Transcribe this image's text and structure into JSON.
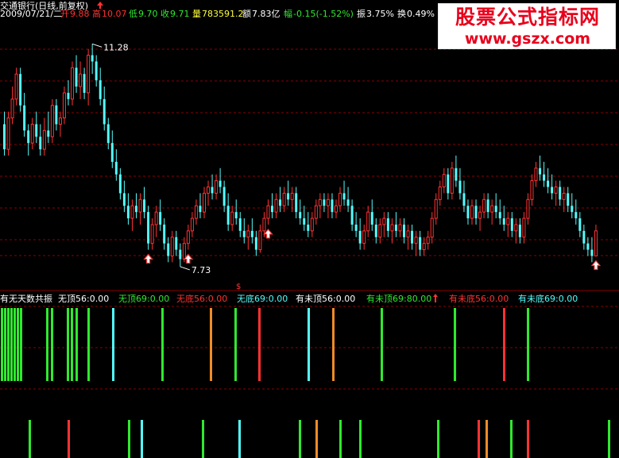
{
  "header": {
    "title": "交通银行(日线,前复权)",
    "date": "2009/07/21/二",
    "open_label": "开",
    "open": "9.88",
    "high_label": "高",
    "high": "10.07",
    "low_label": "低",
    "low": "9.70",
    "close_label": "收",
    "close": "9.71",
    "volume_label": "量",
    "volume": "783591.2",
    "amount_label": "额",
    "amount": "7.83亿",
    "change_label": "幅",
    "change": "-0.15(-1.52%)",
    "amplitude_label": "振",
    "amplitude": "3.75%",
    "turnover_label": "换",
    "turnover": "0.49%"
  },
  "colors": {
    "up": "#ff3232",
    "down": "#54fcfc",
    "background": "#000000",
    "grid": "#8b0000",
    "green": "#2fe92f",
    "orange": "#f08c28",
    "white": "#ffffff",
    "yellow": "#ffff3c"
  },
  "logo": {
    "title": "股票公式指标网",
    "url": "www.gszx.com"
  },
  "indicator": {
    "name": "有无天数共振",
    "entries": [
      {
        "label": "无顶56:",
        "value": "0.00",
        "color": "#ffffff"
      },
      {
        "label": "无顶69:",
        "value": "0.00",
        "color": "#2fe92f"
      },
      {
        "label": "无底56:",
        "value": "0.00",
        "color": "#ff3232"
      },
      {
        "label": "无底69:",
        "value": "0.00",
        "color": "#54fcfc"
      },
      {
        "label": "有未顶56:",
        "value": "0.00",
        "color": "#ffffff"
      },
      {
        "label": "有未顶69:",
        "value": "80.00",
        "color": "#2fe92f"
      },
      {
        "label": "有未底56:",
        "value": "0.00",
        "color": "#ff3232"
      },
      {
        "label": "有未底69:",
        "value": "0.00",
        "color": "#54fcfc"
      }
    ]
  },
  "chart_data": {
    "type": "candlestick",
    "ylim": [
      7.4,
      11.6
    ],
    "grid": true,
    "annotations": [
      {
        "text": "11.28",
        "index": 22,
        "price": 11.28,
        "kind": "high"
      },
      {
        "text": "7.73",
        "index": 44,
        "price": 7.73,
        "kind": "low"
      }
    ],
    "buy_arrows": [
      36,
      46,
      66,
      148
    ],
    "candles": [
      [
        10.0,
        10.2,
        9.5,
        9.6
      ],
      [
        9.6,
        10.2,
        9.5,
        10.1
      ],
      [
        10.1,
        10.6,
        10.0,
        10.4
      ],
      [
        10.4,
        10.9,
        10.3,
        10.8
      ],
      [
        10.8,
        10.9,
        10.2,
        10.3
      ],
      [
        10.3,
        10.5,
        9.8,
        9.9
      ],
      [
        9.9,
        10.0,
        9.5,
        9.7
      ],
      [
        9.7,
        10.1,
        9.6,
        10.0
      ],
      [
        10.0,
        10.2,
        9.7,
        9.8
      ],
      [
        9.8,
        10.0,
        9.5,
        9.6
      ],
      [
        9.6,
        10.1,
        9.5,
        9.9
      ],
      [
        9.9,
        10.2,
        9.7,
        9.8
      ],
      [
        9.8,
        10.4,
        9.7,
        10.3
      ],
      [
        10.3,
        10.4,
        9.9,
        10.0
      ],
      [
        10.0,
        10.2,
        9.8,
        10.1
      ],
      [
        10.1,
        10.6,
        10.0,
        10.5
      ],
      [
        10.5,
        10.7,
        10.3,
        10.4
      ],
      [
        10.4,
        11.0,
        10.3,
        10.9
      ],
      [
        10.9,
        11.1,
        10.5,
        10.6
      ],
      [
        10.6,
        11.0,
        10.4,
        10.8
      ],
      [
        10.8,
        10.9,
        10.4,
        10.5
      ],
      [
        10.5,
        11.2,
        10.3,
        11.1
      ],
      [
        11.1,
        11.28,
        10.8,
        11.0
      ],
      [
        11.0,
        11.1,
        10.6,
        10.7
      ],
      [
        10.7,
        10.9,
        10.3,
        10.4
      ],
      [
        10.4,
        10.6,
        9.9,
        10.0
      ],
      [
        10.0,
        10.1,
        9.6,
        9.7
      ],
      [
        9.7,
        9.9,
        9.3,
        9.4
      ],
      [
        9.4,
        9.6,
        9.1,
        9.2
      ],
      [
        9.2,
        9.3,
        8.8,
        8.9
      ],
      [
        8.9,
        9.1,
        8.6,
        8.7
      ],
      [
        8.7,
        8.9,
        8.4,
        8.5
      ],
      [
        8.5,
        8.8,
        8.3,
        8.7
      ],
      [
        8.7,
        8.9,
        8.5,
        8.6
      ],
      [
        8.6,
        8.9,
        8.4,
        8.8
      ],
      [
        8.8,
        9.0,
        8.5,
        8.6
      ],
      [
        8.6,
        8.7,
        8.0,
        8.1
      ],
      [
        8.1,
        8.5,
        8.0,
        8.4
      ],
      [
        8.4,
        8.7,
        8.2,
        8.6
      ],
      [
        8.6,
        8.8,
        8.3,
        8.4
      ],
      [
        8.4,
        8.5,
        8.0,
        8.1
      ],
      [
        8.1,
        8.2,
        7.8,
        7.9
      ],
      [
        7.9,
        8.3,
        7.8,
        8.2
      ],
      [
        8.2,
        8.3,
        7.9,
        8.0
      ],
      [
        8.0,
        8.1,
        7.73,
        7.85
      ],
      [
        7.85,
        8.2,
        7.8,
        8.1
      ],
      [
        8.1,
        8.4,
        8.0,
        8.3
      ],
      [
        8.3,
        8.6,
        8.2,
        8.5
      ],
      [
        8.5,
        8.8,
        8.4,
        8.7
      ],
      [
        8.7,
        8.9,
        8.5,
        8.6
      ],
      [
        8.6,
        9.0,
        8.5,
        8.9
      ],
      [
        8.9,
        9.1,
        8.7,
        9.0
      ],
      [
        9.0,
        9.2,
        8.8,
        8.9
      ],
      [
        8.9,
        9.2,
        8.8,
        9.1
      ],
      [
        9.1,
        9.3,
        8.9,
        9.0
      ],
      [
        9.0,
        9.1,
        8.6,
        8.7
      ],
      [
        8.7,
        8.9,
        8.3,
        8.4
      ],
      [
        8.4,
        8.7,
        8.3,
        8.6
      ],
      [
        8.6,
        8.8,
        8.4,
        8.5
      ],
      [
        8.5,
        8.6,
        8.2,
        8.3
      ],
      [
        8.3,
        8.5,
        8.1,
        8.2
      ],
      [
        8.2,
        8.4,
        8.0,
        8.3
      ],
      [
        8.3,
        8.5,
        8.1,
        8.2
      ],
      [
        8.2,
        8.3,
        7.9,
        8.0
      ],
      [
        8.0,
        8.4,
        7.95,
        8.3
      ],
      [
        8.3,
        8.6,
        8.2,
        8.5
      ],
      [
        8.5,
        8.8,
        8.4,
        8.7
      ],
      [
        8.7,
        8.9,
        8.5,
        8.6
      ],
      [
        8.6,
        8.9,
        8.5,
        8.8
      ],
      [
        8.8,
        9.0,
        8.6,
        8.7
      ],
      [
        8.7,
        9.0,
        8.6,
        8.9
      ],
      [
        8.9,
        9.1,
        8.7,
        8.8
      ],
      [
        8.8,
        9.0,
        8.6,
        8.9
      ],
      [
        8.9,
        9.0,
        8.5,
        8.6
      ],
      [
        8.6,
        8.8,
        8.4,
        8.5
      ],
      [
        8.5,
        8.7,
        8.3,
        8.4
      ],
      [
        8.4,
        8.6,
        8.2,
        8.3
      ],
      [
        8.3,
        8.6,
        8.2,
        8.5
      ],
      [
        8.5,
        8.8,
        8.4,
        8.7
      ],
      [
        8.7,
        8.9,
        8.5,
        8.8
      ],
      [
        8.8,
        8.9,
        8.6,
        8.7
      ],
      [
        8.7,
        8.9,
        8.5,
        8.8
      ],
      [
        8.8,
        8.9,
        8.5,
        8.6
      ],
      [
        8.6,
        8.8,
        8.5,
        8.7
      ],
      [
        8.7,
        9.0,
        8.6,
        8.9
      ],
      [
        8.9,
        9.1,
        8.7,
        8.8
      ],
      [
        8.8,
        9.0,
        8.6,
        8.7
      ],
      [
        8.7,
        8.8,
        8.3,
        8.4
      ],
      [
        8.4,
        8.6,
        8.2,
        8.3
      ],
      [
        8.3,
        8.5,
        8.0,
        8.1
      ],
      [
        8.1,
        8.4,
        8.0,
        8.3
      ],
      [
        8.3,
        8.7,
        8.2,
        8.6
      ],
      [
        8.6,
        8.8,
        8.3,
        8.4
      ],
      [
        8.4,
        8.5,
        8.1,
        8.2
      ],
      [
        8.2,
        8.5,
        8.1,
        8.4
      ],
      [
        8.4,
        8.6,
        8.2,
        8.5
      ],
      [
        8.5,
        8.6,
        8.2,
        8.3
      ],
      [
        8.3,
        8.5,
        8.1,
        8.4
      ],
      [
        8.4,
        8.6,
        8.2,
        8.3
      ],
      [
        8.3,
        8.5,
        8.2,
        8.4
      ],
      [
        8.4,
        8.5,
        8.1,
        8.2
      ],
      [
        8.2,
        8.4,
        8.0,
        8.3
      ],
      [
        8.3,
        8.4,
        8.0,
        8.1
      ],
      [
        8.1,
        8.3,
        7.9,
        8.2
      ],
      [
        8.2,
        8.3,
        7.9,
        8.0
      ],
      [
        8.0,
        8.2,
        7.9,
        8.1
      ],
      [
        8.1,
        8.3,
        8.0,
        8.2
      ],
      [
        8.2,
        8.6,
        8.1,
        8.5
      ],
      [
        8.5,
        8.9,
        8.4,
        8.8
      ],
      [
        8.8,
        9.1,
        8.7,
        9.0
      ],
      [
        9.0,
        9.3,
        8.9,
        9.2
      ],
      [
        9.2,
        9.3,
        8.8,
        8.9
      ],
      [
        8.9,
        9.4,
        8.8,
        9.3
      ],
      [
        9.3,
        9.5,
        9.0,
        9.1
      ],
      [
        9.1,
        9.3,
        8.8,
        8.9
      ],
      [
        8.9,
        9.1,
        8.6,
        8.7
      ],
      [
        8.7,
        8.8,
        8.4,
        8.5
      ],
      [
        8.5,
        8.8,
        8.4,
        8.7
      ],
      [
        8.7,
        8.8,
        8.4,
        8.5
      ],
      [
        8.5,
        8.7,
        8.3,
        8.6
      ],
      [
        8.6,
        8.9,
        8.5,
        8.8
      ],
      [
        8.8,
        8.9,
        8.5,
        8.6
      ],
      [
        8.6,
        8.8,
        8.4,
        8.7
      ],
      [
        8.7,
        8.9,
        8.5,
        8.6
      ],
      [
        8.6,
        8.8,
        8.4,
        8.5
      ],
      [
        8.5,
        8.7,
        8.3,
        8.4
      ],
      [
        8.4,
        8.6,
        8.2,
        8.5
      ],
      [
        8.5,
        8.6,
        8.2,
        8.3
      ],
      [
        8.3,
        8.5,
        8.1,
        8.4
      ],
      [
        8.4,
        8.5,
        8.1,
        8.2
      ],
      [
        8.2,
        8.6,
        8.1,
        8.5
      ],
      [
        8.5,
        8.9,
        8.4,
        8.8
      ],
      [
        8.8,
        9.2,
        8.7,
        9.1
      ],
      [
        9.1,
        9.4,
        9.0,
        9.3
      ],
      [
        9.3,
        9.5,
        9.1,
        9.2
      ],
      [
        9.2,
        9.4,
        9.0,
        9.1
      ],
      [
        9.1,
        9.3,
        8.9,
        9.0
      ],
      [
        9.0,
        9.2,
        8.8,
        8.9
      ],
      [
        8.9,
        9.1,
        8.7,
        9.0
      ],
      [
        9.0,
        9.1,
        8.7,
        8.8
      ],
      [
        8.8,
        9.0,
        8.6,
        8.9
      ],
      [
        8.9,
        9.0,
        8.6,
        8.7
      ],
      [
        8.7,
        8.9,
        8.5,
        8.6
      ],
      [
        8.6,
        8.8,
        8.4,
        8.5
      ],
      [
        8.5,
        8.6,
        8.2,
        8.3
      ],
      [
        8.3,
        8.4,
        8.0,
        8.1
      ],
      [
        8.1,
        8.2,
        7.9,
        8.0
      ],
      [
        8.0,
        8.2,
        7.8,
        7.9
      ],
      [
        7.9,
        8.4,
        7.9,
        8.3
      ]
    ],
    "bars_top": [
      {
        "x": 1,
        "color": "#2fe92f"
      },
      {
        "x": 5,
        "color": "#2fe92f"
      },
      {
        "x": 9,
        "color": "#2fe92f"
      },
      {
        "x": 13,
        "color": "#2fe92f"
      },
      {
        "x": 17,
        "color": "#2fe92f"
      },
      {
        "x": 21,
        "color": "#2fe92f"
      },
      {
        "x": 25,
        "color": "#2fe92f"
      },
      {
        "x": 58,
        "color": "#2fe92f"
      },
      {
        "x": 64,
        "color": "#2fe92f"
      },
      {
        "x": 84,
        "color": "#2fe92f"
      },
      {
        "x": 89,
        "color": "#2fe92f"
      },
      {
        "x": 95,
        "color": "#2fe92f"
      },
      {
        "x": 110,
        "color": "#2fe92f"
      },
      {
        "x": 141,
        "color": "#54fcfc"
      },
      {
        "x": 203,
        "color": "#2fe92f"
      },
      {
        "x": 264,
        "color": "#f08c28"
      },
      {
        "x": 295,
        "color": "#2fe92f"
      },
      {
        "x": 325,
        "color": "#ff3232"
      },
      {
        "x": 387,
        "color": "#54fcfc"
      },
      {
        "x": 418,
        "color": "#f08c28"
      },
      {
        "x": 479,
        "color": "#2fe92f"
      },
      {
        "x": 571,
        "color": "#2fe92f"
      },
      {
        "x": 633,
        "color": "#ff3232"
      },
      {
        "x": 663,
        "color": "#2fe92f"
      }
    ],
    "bars_bottom": [
      {
        "x": 36,
        "color": "#2fe92f"
      },
      {
        "x": 85,
        "color": "#ff3232"
      },
      {
        "x": 161,
        "color": "#2fe92f"
      },
      {
        "x": 177,
        "color": "#54fcfc"
      },
      {
        "x": 254,
        "color": "#2fe92f"
      },
      {
        "x": 300,
        "color": "#54fcfc"
      },
      {
        "x": 376,
        "color": "#2fe92f"
      },
      {
        "x": 397,
        "color": "#f08c28"
      },
      {
        "x": 427,
        "color": "#2fe92f"
      },
      {
        "x": 452,
        "color": "#2fe92f"
      },
      {
        "x": 550,
        "color": "#2fe92f"
      },
      {
        "x": 601,
        "color": "#ff3232"
      },
      {
        "x": 611,
        "color": "#f08c28"
      },
      {
        "x": 642,
        "color": "#2fe92f"
      },
      {
        "x": 663,
        "color": "#ff3232"
      },
      {
        "x": 765,
        "color": "#2fe92f"
      }
    ]
  }
}
